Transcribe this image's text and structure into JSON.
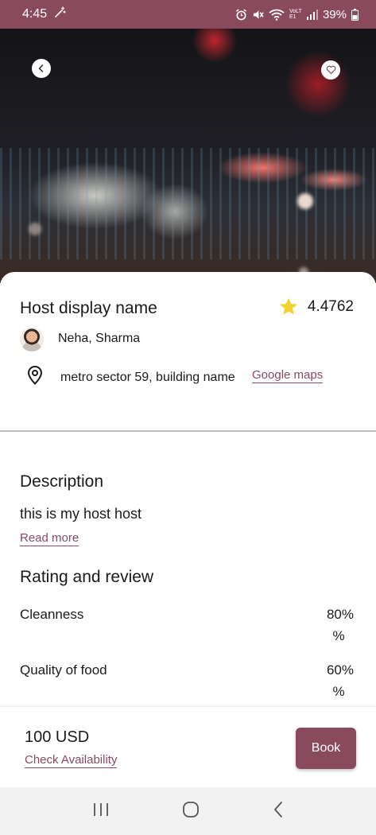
{
  "status_bar": {
    "time": "4:45",
    "battery": "39%",
    "network_label": "VoLTE1"
  },
  "listing": {
    "host_display_name": "Host display name",
    "rating": "4.4762",
    "host_name": "Neha, Sharma",
    "address": "metro sector 59, building name",
    "maps_link": "Google maps"
  },
  "description": {
    "title": "Description",
    "text": "this is my host host",
    "read_more": "Read more"
  },
  "ratings": {
    "title": "Rating and review",
    "items": [
      {
        "label": "Cleanness",
        "value": "80%",
        "unit": "%"
      },
      {
        "label": "Quality of food",
        "value": "60%",
        "unit": "%"
      }
    ]
  },
  "booking": {
    "price": "100 USD",
    "check_availability": "Check Availability",
    "book_label": "Book"
  },
  "icons": {
    "back": "chevron-left-icon",
    "favorite": "heart-icon",
    "rating": "star-icon",
    "location": "map-pin-icon"
  },
  "colors": {
    "accent": "#8a4a5e",
    "star": "#f2d22e",
    "divider": "#bdbdbd"
  }
}
